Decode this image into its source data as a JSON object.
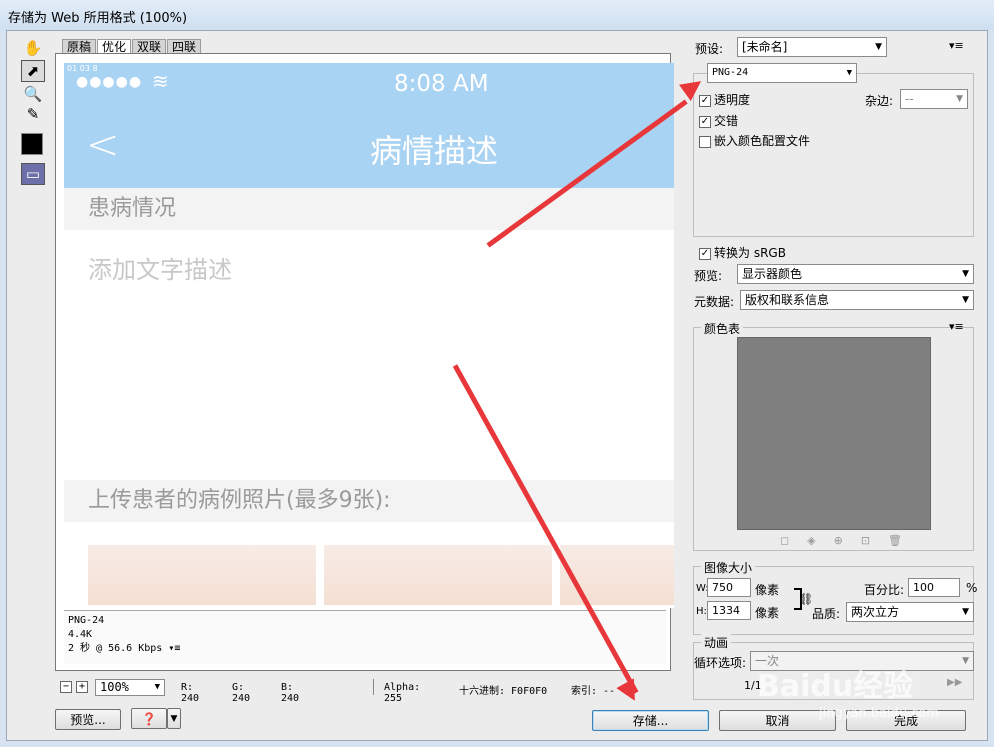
{
  "window": {
    "title": "存储为 Web 所用格式 (100%)"
  },
  "tabs": [
    "原稿",
    "优化",
    "双联",
    "四联"
  ],
  "preview": {
    "status_info": "01 03 8",
    "time": "8:08 AM",
    "back": "<",
    "title": "病情描述",
    "section1": "患病情况",
    "placeholder": "添加文字描述",
    "upload": "上传患者的病例照片(最多9张):"
  },
  "info": {
    "format": "PNG-24",
    "size": "4.4K",
    "speed": "2 秒 @ 56.6 Kbps"
  },
  "bottombar": {
    "zoom": "100%",
    "r": "R: 240",
    "g": "G: 240",
    "b": "B: 240",
    "alpha": "Alpha: 255",
    "hex": "十六进制: F0F0F0",
    "index": "索引: --"
  },
  "buttons": {
    "preview": "预览...",
    "save": "存储...",
    "cancel": "取消",
    "done": "完成"
  },
  "settings": {
    "preset_label": "预设:",
    "preset_value": "[未命名]",
    "format": "PNG-24",
    "transparency": "透明度",
    "matte_label": "杂边:",
    "matte_value": "--",
    "interlaced": "交错",
    "embed_profile": "嵌入颜色配置文件",
    "convert_srgb": "转换为 sRGB",
    "preview_label": "预览:",
    "preview_value": "显示器颜色",
    "metadata_label": "元数据:",
    "metadata_value": "版权和联系信息",
    "colortable_label": "颜色表",
    "image_size_label": "图像大小",
    "w_label": "W:",
    "w_value": "750",
    "w_unit": "像素",
    "h_label": "H:",
    "h_value": "1334",
    "h_unit": "像素",
    "percent_label": "百分比:",
    "percent_value": "100",
    "percent_unit": "%",
    "quality_label": "品质:",
    "quality_value": "两次立方",
    "animation_label": "动画",
    "loop_label": "循环选项:",
    "loop_value": "一次",
    "frame": "1/1"
  },
  "watermark": {
    "brand": "Baidu经验",
    "url": "jingyan.baidu.com"
  },
  "colors": {
    "accent_arrow": "#e8373a",
    "nav_blue": "#a9d3f2"
  }
}
